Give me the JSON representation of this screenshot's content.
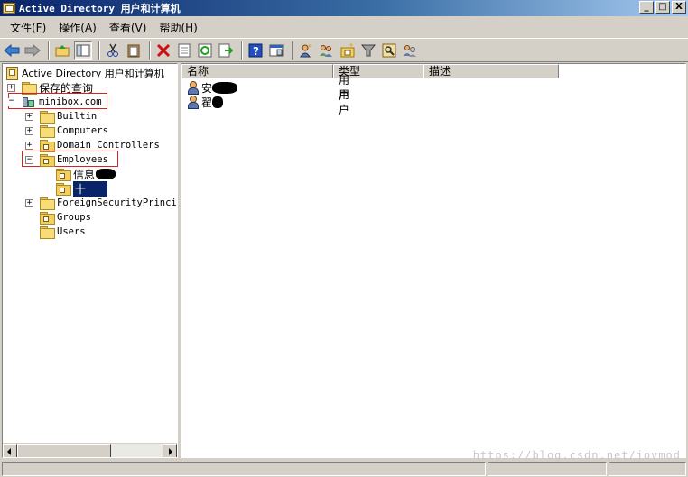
{
  "window": {
    "title": "Active Directory 用户和计算机",
    "controls": [
      "_",
      "□",
      "X"
    ]
  },
  "menu": [
    "文件(F)",
    "操作(A)",
    "查看(V)",
    "帮助(H)"
  ],
  "toolbar": {
    "icons": [
      "back-icon",
      "forward-icon",
      "up-icon",
      "show-tree-icon",
      "cut-icon",
      "paste-icon",
      "delete-icon",
      "properties-icon",
      "refresh-icon",
      "export-icon",
      "help-icon",
      "console-icon",
      "new-user-icon",
      "new-group-icon",
      "new-ou-icon",
      "filter-icon",
      "find-icon",
      "add-to-group-icon"
    ]
  },
  "tree": {
    "root": "Active Directory 用户和计算机",
    "saved_queries": "保存的查询",
    "domain": "minibox.com",
    "builtin": "Builtin",
    "computers": "Computers",
    "domain_controllers": "Domain Controllers",
    "employees": "Employees",
    "sub_ou_1": "信息",
    "sub_ou_2": "十",
    "foreign": "ForeignSecurityPrincip",
    "groups": "Groups",
    "users": "Users"
  },
  "list": {
    "columns": [
      "名称",
      "类型",
      "描述"
    ],
    "rows": [
      {
        "name": "安",
        "type": "用户",
        "description": ""
      },
      {
        "name": "翟",
        "type": "用户",
        "description": ""
      }
    ]
  },
  "watermark": "https://blog.csdn.net/jovmod",
  "colors": {
    "title_bar": "#0a246a",
    "selection": "#0a246a",
    "highlight_box": "#e02020"
  }
}
